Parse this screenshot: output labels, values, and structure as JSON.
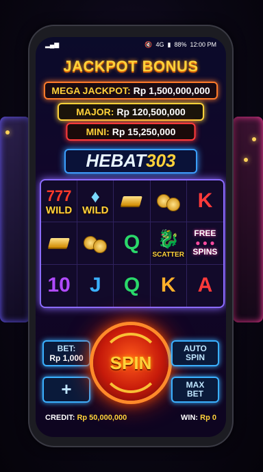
{
  "status": {
    "time": "12:00 PM",
    "battery": "88%",
    "signal": "4G"
  },
  "jackpot": {
    "title": "JACKPOT BONUS",
    "mega_label": "MEGA JACKPOT:",
    "mega_value": "Rp 1,500,000,000",
    "major_label": "MAJOR:",
    "major_value": "Rp 120,500,000",
    "mini_label": "MINI:",
    "mini_value": "Rp 15,250,000"
  },
  "brand": {
    "name": "HEBAT",
    "num": "303"
  },
  "reels": {
    "row1": [
      "777 WILD",
      "DIAMOND WILD",
      "GOLD BARS",
      "COINS",
      "K"
    ],
    "row2": [
      "GOLD BARS",
      "COINS",
      "Q",
      "SCATTER",
      "FREE SPINS"
    ],
    "row3": [
      "10",
      "J",
      "Q",
      "K",
      "A"
    ],
    "wild_label": "WILD",
    "scatter_label": "SCATTER",
    "free_label_1": "FREE",
    "free_label_2": "SPINS",
    "sym_k": "K",
    "sym_q": "Q",
    "sym_10": "10",
    "sym_j": "J",
    "sym_a": "A"
  },
  "controls": {
    "bet_label": "BET:",
    "bet_value": "Rp 1,000",
    "plus": "+",
    "spin": "SPIN",
    "auto_1": "AUTO",
    "auto_2": "SPIN",
    "max_1": "MAX",
    "max_2": "BET"
  },
  "footer": {
    "credit_label": "CREDIT:",
    "credit_value": "Rp 50,000,000",
    "win_label": "WIN:",
    "win_value": "Rp 0"
  },
  "colors": {
    "accent_gold": "#ffd23a",
    "neon_blue": "#3ab0ff",
    "neon_purple": "#8c6cff",
    "spin_red": "#c61a0a"
  }
}
